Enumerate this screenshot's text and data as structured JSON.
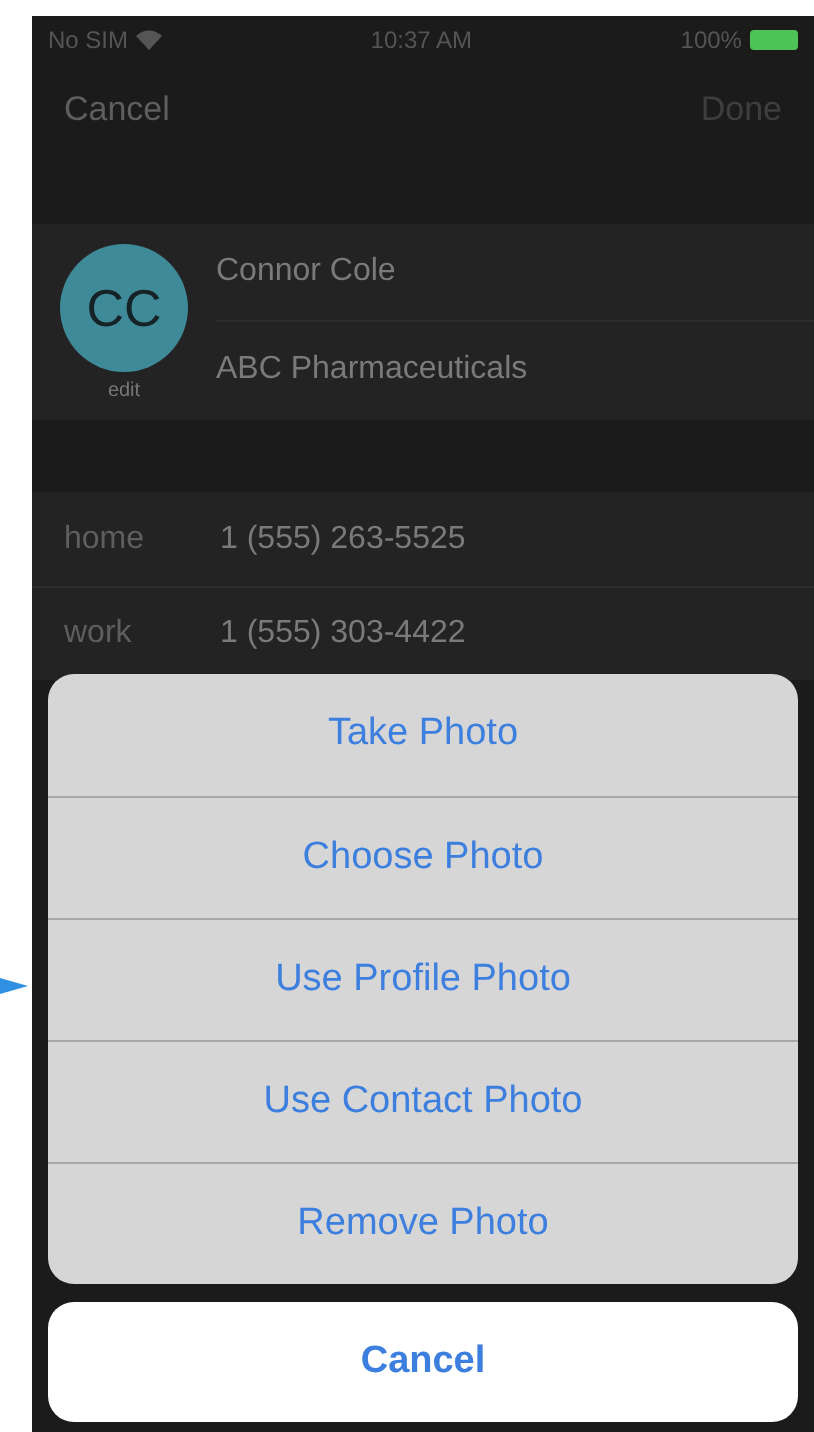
{
  "status_bar": {
    "carrier": "No SIM",
    "time": "10:37 AM",
    "battery": "100%"
  },
  "nav": {
    "left": "Cancel",
    "right": "Done"
  },
  "contact": {
    "initials": "CC",
    "edit": "edit",
    "name": "Connor Cole",
    "company": "ABC Pharmaceuticals"
  },
  "phones": [
    {
      "label": "home",
      "number": "1 (555) 263-5525"
    },
    {
      "label": "work",
      "number": "1 (555) 303-4422"
    }
  ],
  "action_sheet": {
    "actions": [
      "Take Photo",
      "Choose Photo",
      "Use Profile Photo",
      "Use Contact Photo",
      "Remove Photo"
    ],
    "cancel": "Cancel"
  }
}
